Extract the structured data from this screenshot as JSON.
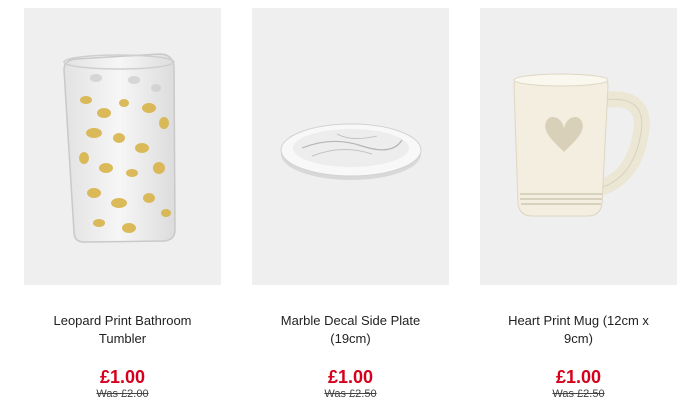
{
  "products": [
    {
      "name": "Leopard Print Bathroom Tumbler",
      "price": "£1.00",
      "was": "Was £2.00",
      "image": "leopard-tumbler"
    },
    {
      "name": "Marble Decal Side Plate (19cm)",
      "price": "£1.00",
      "was": "Was £2.50",
      "image": "marble-plate"
    },
    {
      "name": "Heart Print Mug (12cm x 9cm)",
      "price": "£1.00",
      "was": "Was £2.50",
      "image": "heart-mug"
    }
  ],
  "colors": {
    "sale": "#d6001c",
    "image_bg": "#efefef"
  }
}
